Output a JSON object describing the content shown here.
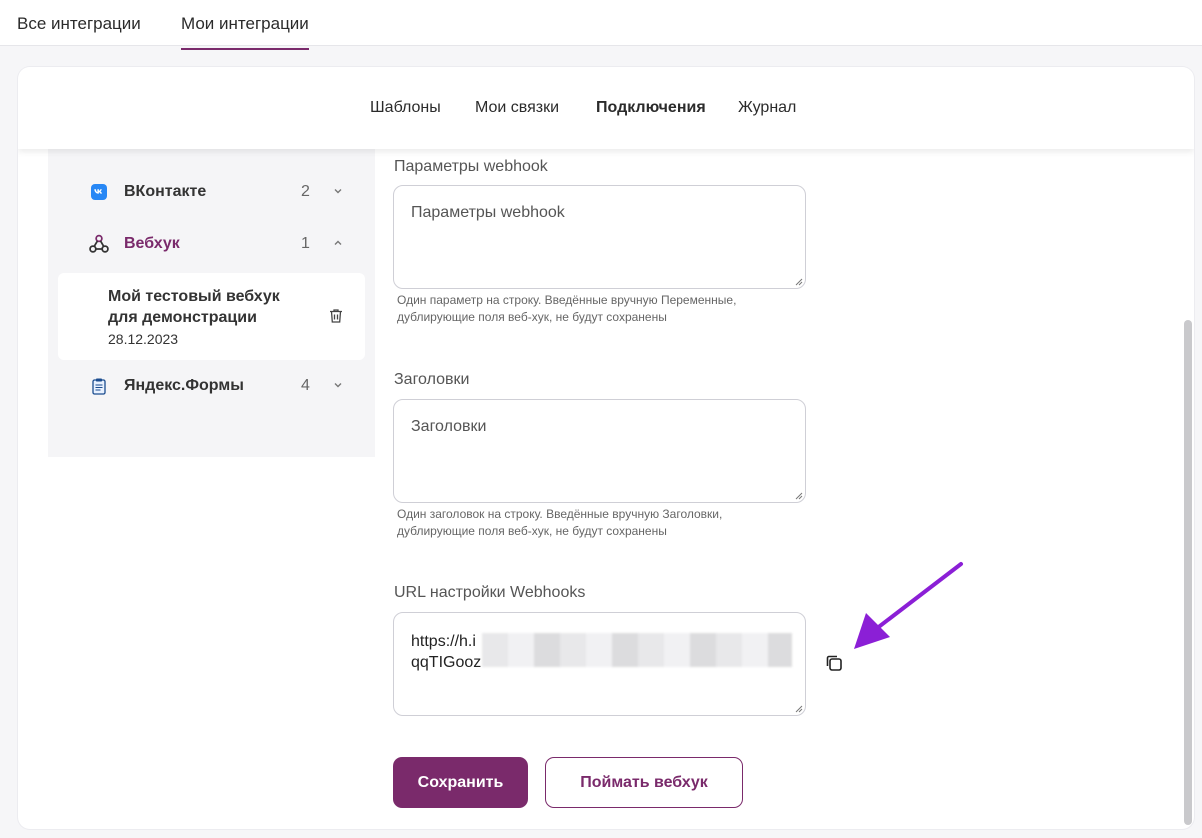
{
  "top_tabs": [
    {
      "label": "Все интеграции"
    },
    {
      "label": "Мои интеграции",
      "active": true
    }
  ],
  "sub_tabs": [
    {
      "label": "Шаблоны"
    },
    {
      "label": "Мои связки"
    },
    {
      "label": "Подключения",
      "active": true
    },
    {
      "label": "Журнал"
    }
  ],
  "sidebar": {
    "items": [
      {
        "name": "ВКонтакте",
        "count": "2",
        "icon": "vk-icon",
        "expanded": false
      },
      {
        "name": "Вебхук",
        "count": "1",
        "icon": "webhook-icon",
        "expanded": true
      },
      {
        "name": "Яндекс.Формы",
        "count": "4",
        "icon": "clipboard-icon",
        "expanded": false
      }
    ],
    "webhook_item": {
      "title": "Мой тестовый вебхук для демонстрации",
      "date": "28.12.2023"
    }
  },
  "form": {
    "params": {
      "label": "Параметры webhook",
      "placeholder": "Параметры webhook",
      "hint": "Один параметр на строку. Введённые вручную Переменные, дублирующие поля веб-хук, не будут сохранены"
    },
    "headers": {
      "label": "Заголовки",
      "placeholder": "Заголовки",
      "hint": "Один заголовок на строку. Введённые вручную Заголовки, дублирующие поля веб-хук, не будут сохранены"
    },
    "url": {
      "label": "URL настройки Webhooks",
      "line1": "https://h.i",
      "line2": "qqTIGooz"
    }
  },
  "buttons": {
    "save": "Сохранить",
    "catch": "Поймать вебхук"
  },
  "colors": {
    "accent": "#7a2a6b",
    "arrow": "#8b1fd6"
  }
}
